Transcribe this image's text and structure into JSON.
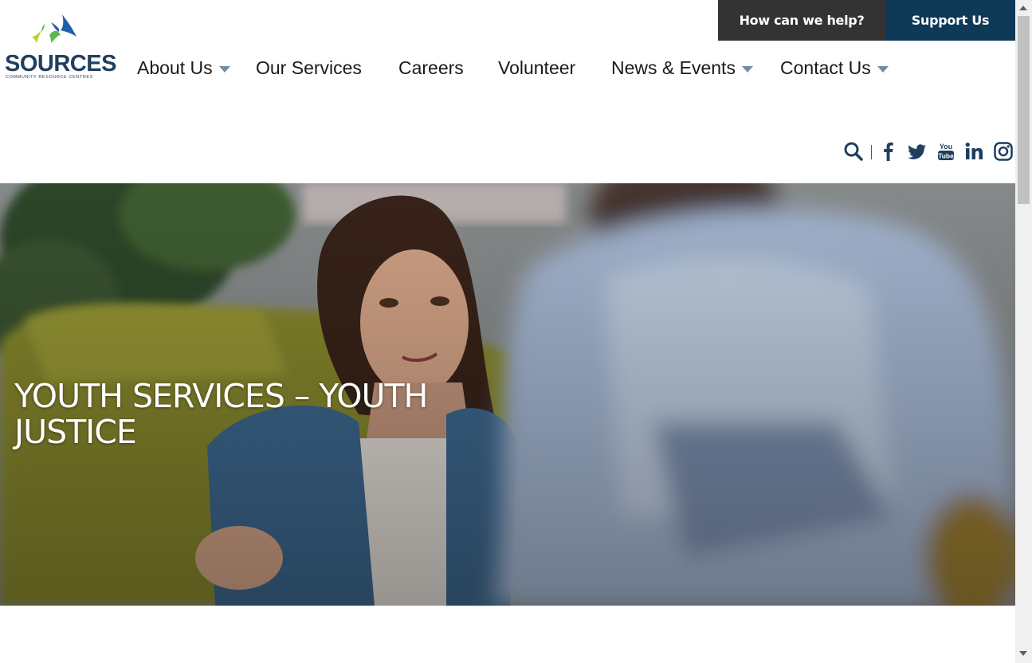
{
  "logo": {
    "name": "SOURCES",
    "tagline": "COMMUNITY RESOURCE CENTRES"
  },
  "top_buttons": {
    "help": "How can we help?",
    "support": "Support Us"
  },
  "nav": [
    {
      "label": "About Us",
      "has_dropdown": true
    },
    {
      "label": "Our Services",
      "has_dropdown": false
    },
    {
      "label": "Careers",
      "has_dropdown": false
    },
    {
      "label": "Volunteer",
      "has_dropdown": false
    },
    {
      "label": "News & Events",
      "has_dropdown": true
    },
    {
      "label": "Contact Us",
      "has_dropdown": true
    }
  ],
  "icons": [
    "search-icon",
    "facebook-icon",
    "twitter-icon",
    "youtube-icon",
    "linkedin-icon",
    "instagram-icon"
  ],
  "hero": {
    "title": "YOUTH SERVICES – YOUTH JUSTICE"
  },
  "colors": {
    "brand_dark": "#0e3a57",
    "help_bg": "#333333",
    "caret": "#6e8ea8",
    "icon": "#1f3f5f"
  }
}
